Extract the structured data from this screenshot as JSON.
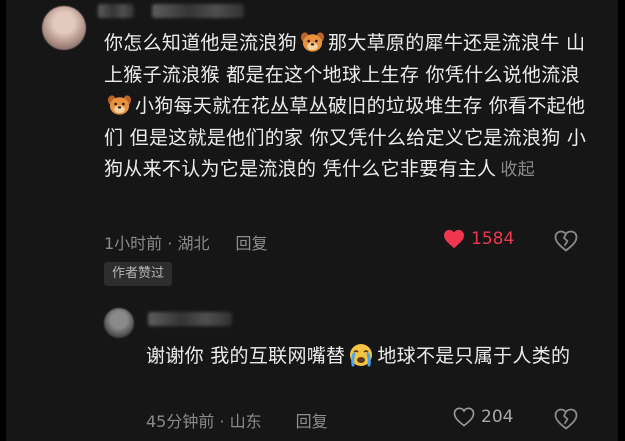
{
  "comment": {
    "text_segments": [
      "你怎么知道他是流浪狗",
      "那大草原的犀牛还是流浪牛 山上猴子流浪猴 都是在这个地球上生存 你凭什么说他流浪",
      "小狗每天就在花丛草丛破旧的垃圾堆生存 你看不起他们 但是这就是他们的家 你又凭什么给定义它是流浪狗 小狗从来不认为它是流浪的 凭什么它非要有主人"
    ],
    "collapse_label": "收起",
    "time_location": "1小时前 · 湖北",
    "reply_label": "回复",
    "like_count": "1584",
    "author_liked_badge": "作者赞过",
    "emoji": "dog-face-emoji",
    "liked_color": "#f0364f"
  },
  "reply": {
    "text_segments": [
      "谢谢你 我的互联网嘴替",
      "地球不是只属于人类的"
    ],
    "time_location": "45分钟前 · 山东",
    "reply_label": "回复",
    "like_count": "204",
    "emoji": "crying-face-emoji"
  }
}
